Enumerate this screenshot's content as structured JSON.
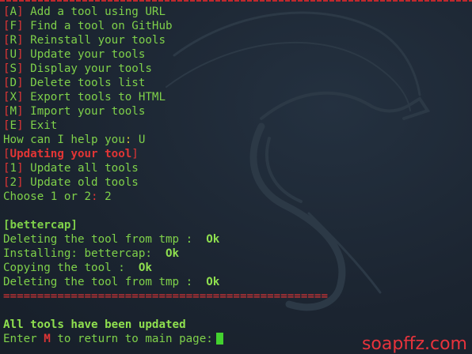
{
  "menu": [
    {
      "open": "[",
      "key": "A",
      "close": "]",
      "text": " Add a tool using URL"
    },
    {
      "open": "[",
      "key": "F",
      "close": "]",
      "text": " Find a tool on GitHub"
    },
    {
      "open": "[",
      "key": "R",
      "close": "]",
      "text": " Reinstall your tools"
    },
    {
      "open": "[",
      "key": "U",
      "close": "]",
      "text": " Update your tools"
    },
    {
      "open": "[",
      "key": "S",
      "close": "]",
      "text": " Display your tools"
    },
    {
      "open": "[",
      "key": "D",
      "close": "]",
      "text": " Delete tools list"
    },
    {
      "open": "[",
      "key": "X",
      "close": "]",
      "text": " Export tools to HTML"
    },
    {
      "open": "[",
      "key": "M",
      "close": "]",
      "text": " Import your tools"
    },
    {
      "open": "[",
      "key": "E",
      "close": "]",
      "text": " Exit"
    }
  ],
  "prompt": {
    "question": "How can I help you",
    "colon": ": ",
    "answer": "U"
  },
  "update_header": {
    "open": "[",
    "text": "Updating your tool",
    "close": "]"
  },
  "submenu": [
    {
      "open": "[",
      "key": "1",
      "close": "]",
      "text": " Update all tools"
    },
    {
      "open": "[",
      "key": "2",
      "close": "]",
      "text": " Update old tools"
    }
  ],
  "choice": {
    "question": "Choose 1 or 2",
    "colon": ": ",
    "answer": "2"
  },
  "log": {
    "tool": "[bettercap]",
    "lines": [
      {
        "text": "Deleting the tool from tmp :  ",
        "status": "Ok"
      },
      {
        "text": "Installing: bettercap:  ",
        "status": "Ok"
      },
      {
        "text": "Copying the tool :  ",
        "status": "Ok"
      },
      {
        "text": "Deleting the tool from tmp :  ",
        "status": "Ok"
      }
    ]
  },
  "separator": "================================================",
  "done_message": "All tools have been updated",
  "return_prompt": {
    "prefix": "Enter ",
    "key": "M",
    "suffix": " to return to main page:"
  },
  "watermark": "soapffz.com",
  "colors": {
    "background": "#1d2631",
    "text_green": "#7fd14a",
    "accent_red": "#e23535",
    "prompt_gold": "#d6c23a",
    "cursor_green": "#43d12f"
  }
}
